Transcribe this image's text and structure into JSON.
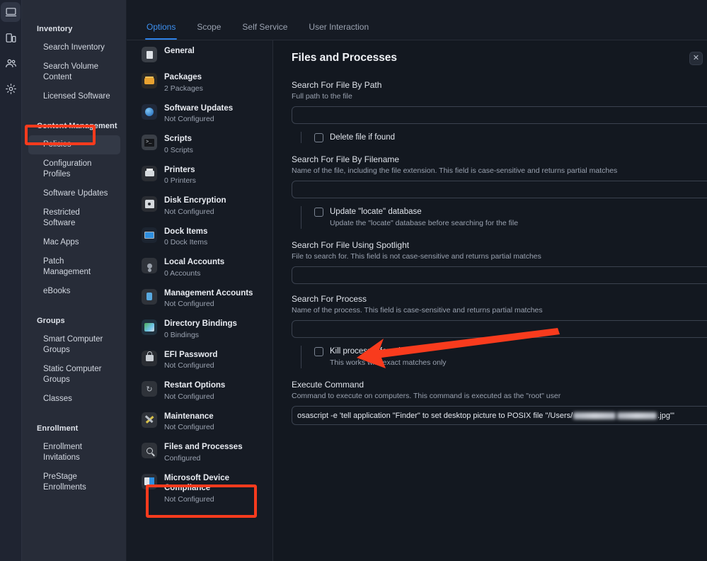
{
  "rail": {
    "items": [
      {
        "name": "computers-icon",
        "label": "Computers",
        "active": true
      },
      {
        "name": "mobile-devices-icon",
        "label": "Mobile Devices",
        "active": false
      },
      {
        "name": "users-icon",
        "label": "Users",
        "active": false
      },
      {
        "name": "settings-gear-icon",
        "label": "Settings",
        "active": false
      }
    ]
  },
  "sidebar": {
    "sections": [
      {
        "title": "Inventory",
        "items": [
          {
            "label": "Search Inventory",
            "selected": false
          },
          {
            "label": "Search Volume Content",
            "selected": false
          },
          {
            "label": "Licensed Software",
            "selected": false
          }
        ]
      },
      {
        "title": "Content Management",
        "items": [
          {
            "label": "Policies",
            "selected": true
          },
          {
            "label": "Configuration Profiles",
            "selected": false
          },
          {
            "label": "Software Updates",
            "selected": false
          },
          {
            "label": "Restricted Software",
            "selected": false
          },
          {
            "label": "Mac Apps",
            "selected": false
          },
          {
            "label": "Patch Management",
            "selected": false
          },
          {
            "label": "eBooks",
            "selected": false
          }
        ]
      },
      {
        "title": "Groups",
        "items": [
          {
            "label": "Smart Computer Groups",
            "selected": false
          },
          {
            "label": "Static Computer Groups",
            "selected": false
          },
          {
            "label": "Classes",
            "selected": false
          }
        ]
      },
      {
        "title": "Enrollment",
        "items": [
          {
            "label": "Enrollment Invitations",
            "selected": false
          },
          {
            "label": "PreStage Enrollments",
            "selected": false
          }
        ]
      }
    ]
  },
  "tabs": [
    {
      "label": "Options",
      "active": true
    },
    {
      "label": "Scope",
      "active": false
    },
    {
      "label": "Self Service",
      "active": false
    },
    {
      "label": "User Interaction",
      "active": false
    }
  ],
  "payloads": [
    {
      "title": "General",
      "sub": "",
      "icon": "general-icon",
      "selected": false
    },
    {
      "title": "Packages",
      "sub": "2 Packages",
      "icon": "packages-icon",
      "selected": false
    },
    {
      "title": "Software Updates",
      "sub": "Not Configured",
      "icon": "software-updates-icon",
      "selected": false
    },
    {
      "title": "Scripts",
      "sub": "0 Scripts",
      "icon": "scripts-icon",
      "selected": false
    },
    {
      "title": "Printers",
      "sub": "0 Printers",
      "icon": "printers-icon",
      "selected": false
    },
    {
      "title": "Disk Encryption",
      "sub": "Not Configured",
      "icon": "disk-encryption-icon",
      "selected": false
    },
    {
      "title": "Dock Items",
      "sub": "0 Dock Items",
      "icon": "dock-items-icon",
      "selected": false
    },
    {
      "title": "Local Accounts",
      "sub": "0 Accounts",
      "icon": "local-accounts-icon",
      "selected": false
    },
    {
      "title": "Management Accounts",
      "sub": "Not Configured",
      "icon": "management-accounts-icon",
      "selected": false
    },
    {
      "title": "Directory Bindings",
      "sub": "0 Bindings",
      "icon": "directory-bindings-icon",
      "selected": false
    },
    {
      "title": "EFI Password",
      "sub": "Not Configured",
      "icon": "efi-password-icon",
      "selected": false
    },
    {
      "title": "Restart Options",
      "sub": "Not Configured",
      "icon": "restart-options-icon",
      "selected": false
    },
    {
      "title": "Maintenance",
      "sub": "Not Configured",
      "icon": "maintenance-icon",
      "selected": false
    },
    {
      "title": "Files and Processes",
      "sub": "Configured",
      "icon": "files-and-processes-icon",
      "selected": true
    },
    {
      "title": "Microsoft Device Compliance",
      "sub": "Not Configured",
      "icon": "microsoft-device-compliance-icon",
      "selected": false
    }
  ],
  "pane": {
    "title": "Files and Processes",
    "close_label": "✕",
    "fields": [
      {
        "label": "Search For File By Path",
        "help": "Full path to the file",
        "value": "",
        "checkbox": {
          "label": "Delete file if found",
          "sub": "",
          "checked": false
        }
      },
      {
        "label": "Search For File By Filename",
        "help": "Name of the file, including the file extension. This field is case-sensitive and returns partial matches",
        "value": "",
        "checkbox": {
          "label": "Update \"locate\" database",
          "sub": "Update the \"locate\" database before searching for the file",
          "checked": false
        }
      },
      {
        "label": "Search For File Using Spotlight",
        "help": "File to search for. This field is not case-sensitive and returns partial matches",
        "value": "",
        "checkbox": null
      },
      {
        "label": "Search For Process",
        "help": "Name of the process. This field is case-sensitive and returns partial matches",
        "value": "",
        "checkbox": {
          "label": "Kill process if found",
          "sub": "This works with exact matches only",
          "checked": false
        }
      }
    ],
    "execute_command": {
      "label": "Execute Command",
      "help": "Command to execute on computers. This command is executed as the \"root\" user",
      "value_prefix": "osascript -e 'tell application \"Finder\" to set desktop picture to POSIX file \"/Users/",
      "value_suffix": ".jpg\"'",
      "redacted": true
    }
  },
  "annotations": {
    "accent_color": "#f93b1d",
    "boxes": [
      {
        "name": "policies-highlight-box"
      },
      {
        "name": "files-and-processes-highlight-box"
      }
    ],
    "arrow": {
      "name": "execute-command-arrow",
      "points_to": "Execute Command"
    }
  }
}
